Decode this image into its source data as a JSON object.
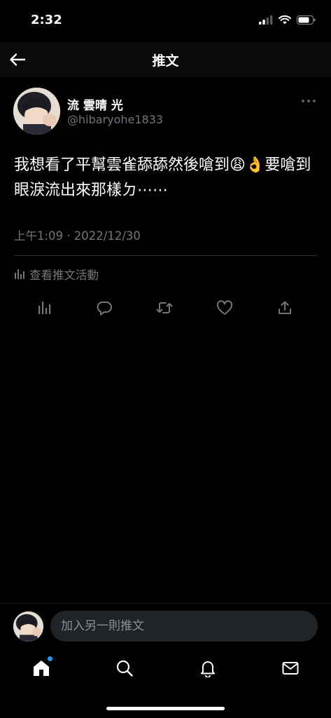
{
  "status_bar": {
    "time": "2:32",
    "icons": [
      "cellular-signal-icon",
      "wifi-icon",
      "battery-icon"
    ]
  },
  "header": {
    "back_icon": "back-arrow-icon",
    "title": "推文"
  },
  "tweet": {
    "author_name": "流 雲晴 光",
    "author_handle": "@hibaryohe1833",
    "more_icon": "more-dots-icon",
    "text": "我想看了平幫雲雀舔舔然後嗆到😩👌要嗆到眼淚流出來那樣ㄉ⋯⋯",
    "timestamp": "上午1:09 · 2022/12/30",
    "analytics_label": "查看推文活動",
    "actions": [
      "analytics-icon",
      "reply-icon",
      "retweet-icon",
      "like-icon",
      "share-icon"
    ]
  },
  "reply": {
    "placeholder": "加入另一則推文"
  },
  "tabbar": {
    "tabs": [
      "home-icon",
      "search-icon",
      "notifications-icon",
      "messages-icon"
    ],
    "accent": "#1d9bf0"
  },
  "colors": {
    "background": "#000000",
    "secondary_text": "#71767b",
    "divider": "#2f3336"
  }
}
